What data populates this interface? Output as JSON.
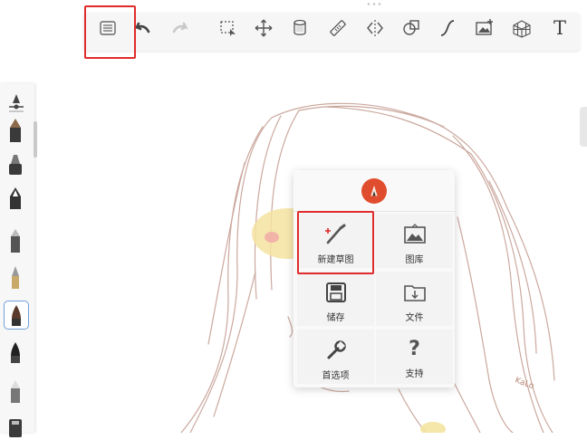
{
  "toolbar": {
    "buttons": [
      {
        "icon": "list-icon"
      },
      {
        "icon": "undo-icon"
      },
      {
        "icon": "redo-icon"
      },
      {
        "icon": "selection-icon"
      },
      {
        "icon": "move-icon"
      },
      {
        "icon": "cylinder-icon"
      },
      {
        "icon": "ruler-icon"
      },
      {
        "icon": "symmetry-icon"
      },
      {
        "icon": "shape-icon"
      },
      {
        "icon": "curve-icon"
      },
      {
        "icon": "add-image-icon"
      },
      {
        "icon": "perspective-icon"
      },
      {
        "icon": "text-icon",
        "glyph": "T"
      }
    ]
  },
  "palette": {
    "selected_index": 7,
    "brushes": [
      "brush-1",
      "brush-2",
      "brush-3",
      "brush-4",
      "brush-5",
      "brush-6",
      "brush-7",
      "brush-8",
      "brush-9",
      "brush-10"
    ]
  },
  "menu": {
    "logo": "sketchbook-logo-icon",
    "items": [
      {
        "label": "新建草图",
        "icon": "new-sketch-icon"
      },
      {
        "label": "图库",
        "icon": "gallery-icon"
      },
      {
        "label": "储存",
        "icon": "save-icon"
      },
      {
        "label": "文件",
        "icon": "folder-icon"
      },
      {
        "label": "首选项",
        "icon": "wrench-icon"
      },
      {
        "label": "支持",
        "icon": "question-icon",
        "glyph": "?"
      }
    ]
  },
  "colors": {
    "highlight": "#e02b2b",
    "sketch_stroke": "#b9897a",
    "logo": "#e04d2e",
    "selected_brush_border": "#6f9fd8"
  },
  "canvas": {
    "signature": "KaLo"
  }
}
